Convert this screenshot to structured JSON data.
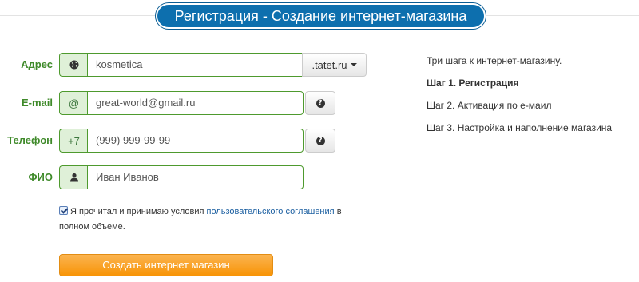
{
  "header": {
    "title": "Регистрация - Создание интернет-магазина"
  },
  "form": {
    "address": {
      "label": "Адрес",
      "icon": "globe-icon",
      "value": "kosmetica",
      "domain": ".tatet.ru"
    },
    "email": {
      "label": "E-mail",
      "addon": "@",
      "value": "great-world@gmail.ru",
      "help_icon": "question-icon"
    },
    "phone": {
      "label": "Телефон",
      "addon": "+7",
      "value": "(999) 999-99-99",
      "help_icon": "question-icon"
    },
    "name": {
      "label": "ФИО",
      "icon": "user-icon",
      "value": "Иван Иванов"
    },
    "agreement": {
      "checked": true,
      "text_before": "Я прочитал и принимаю условия",
      "link": "пользовательского соглашения",
      "text_after": "в полном объеме."
    },
    "submit_label": "Создать интернет магазин"
  },
  "steps": {
    "intro": "Три шага к интернет-магазину.",
    "items": [
      "Шаг 1. Регистрация",
      "Шаг 2. Активация по е-маил",
      "Шаг 3. Настройка и наполнение магазина"
    ],
    "active_index": 0
  },
  "colors": {
    "title_bg": "#0d6fae",
    "label_green": "#3f8a2a",
    "field_border": "#4e9a2e",
    "addon_bg": "#dff0d8",
    "button_orange": "#f89406",
    "link_blue": "#1a5ea0"
  }
}
